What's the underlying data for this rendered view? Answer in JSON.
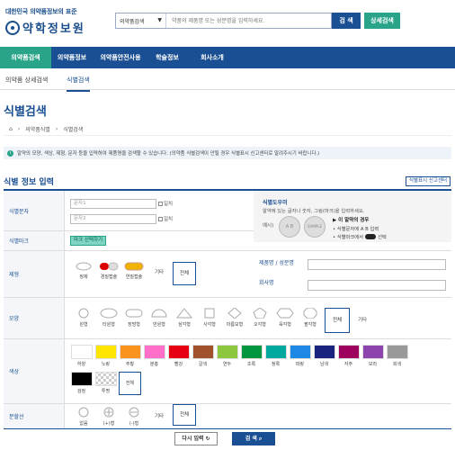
{
  "header": {
    "logo_sub": "대한민국 의약품정보의 표준",
    "logo_main": "약학정보원",
    "search_select": "의약품검색",
    "search_placeholder": "약품의 제품명 또는 성분명을 입력하세요.",
    "search_button": "검 색",
    "advanced_button": "상세검색"
  },
  "gnb": [
    "의약품검색",
    "의약품정보",
    "의약품안전사용",
    "학술정보",
    "회사소개"
  ],
  "subnav": [
    "의약품 상세검색",
    "식별검색"
  ],
  "page_title": "식별검색",
  "breadcrumb": [
    "의약품식별",
    "식별검색"
  ],
  "notice": "알약의 모양, 색상, 제형, 문자 등을 입력하여 제품명을 검색할 수 있습니다. (의약품 식별검색이 안될 경우 식별표시 신고센터로 알려주시기 바랍니다.)",
  "section_title": "식별 정보 입력",
  "report_button": "식별표시 신고센터",
  "form": {
    "mark_text_label": "식별문자",
    "text1_placeholder": "문자1",
    "text2_placeholder": "문자2",
    "exact_label": "일치",
    "mark_label": "식별마크",
    "mark_button": "마크 선택하기",
    "guide_title": "식별도우미",
    "guide_desc": "알약에 있는 글자나 숫자, 그림(마크)을 입력하세요.",
    "guide_example": "예시)",
    "guide_sample_a": "A B",
    "guide_sample_b": "SAMPLE",
    "guide_case": "▶ 이 알약의 경우",
    "guide_line1": "• 식별문자에 A B 입력",
    "guide_line2": "• 식별마크에서",
    "guide_line2_end": "선택",
    "form_label": "제형",
    "forms": [
      "정제",
      "경질캡슐",
      "연질캡슐",
      "기타",
      "전체"
    ],
    "product_label": "제품명 / 성분명",
    "company_label": "회사명",
    "shape_label": "모양",
    "shapes": [
      "원형",
      "타원형",
      "장방형",
      "반원형",
      "삼각형",
      "사각형",
      "마름모형",
      "오각형",
      "육각형",
      "팔각형",
      "전체",
      "기타"
    ],
    "color_label": "색상",
    "colors": [
      {
        "name": "하양",
        "hex": "#ffffff"
      },
      {
        "name": "노랑",
        "hex": "#ffe600"
      },
      {
        "name": "주황",
        "hex": "#f7931e"
      },
      {
        "name": "분홍",
        "hex": "#ff6ec7"
      },
      {
        "name": "빨강",
        "hex": "#e60012"
      },
      {
        "name": "갈색",
        "hex": "#a0522d"
      },
      {
        "name": "연두",
        "hex": "#8dc63f"
      },
      {
        "name": "초록",
        "hex": "#00963f"
      },
      {
        "name": "청록",
        "hex": "#00a99d"
      },
      {
        "name": "파랑",
        "hex": "#1e88e5"
      },
      {
        "name": "남색",
        "hex": "#1a237e"
      },
      {
        "name": "자주",
        "hex": "#9e005d"
      },
      {
        "name": "보라",
        "hex": "#8e44ad"
      },
      {
        "name": "회색",
        "hex": "#999999"
      },
      {
        "name": "검정",
        "hex": "#000000"
      },
      {
        "name": "투명",
        "hex": "transparent"
      },
      {
        "name": "전체",
        "hex": "#ffffff"
      }
    ],
    "divide_label": "분할선",
    "divides": [
      "없음",
      "(+)형",
      "(-)형",
      "기타",
      "전체"
    ]
  },
  "bottom": {
    "reset": "다시 입력",
    "search": "검 색"
  }
}
